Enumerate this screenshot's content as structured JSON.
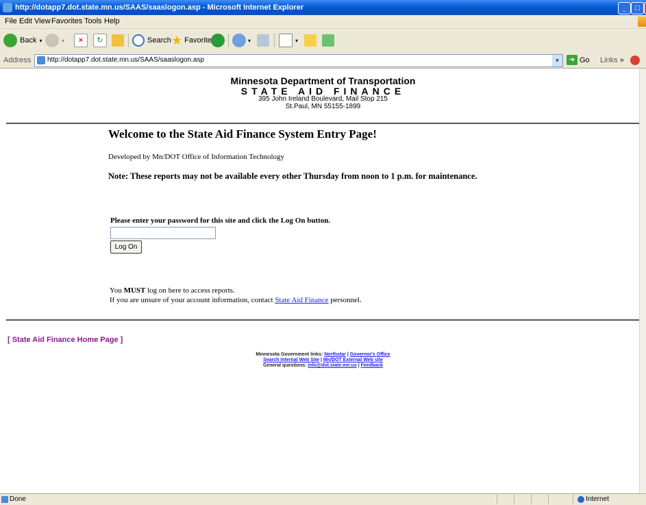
{
  "window": {
    "title": "http://dotapp7.dot.state.mn.us/SAAS/saaslogon.asp - Microsoft Internet Explorer"
  },
  "menu": {
    "items": [
      "File",
      "Edit",
      "View",
      "Favorites",
      "Tools",
      "Help"
    ]
  },
  "toolbar": {
    "back_label": "Back",
    "search_label": "Search",
    "favorites_label": "Favorites"
  },
  "address": {
    "label": "Address",
    "url": "http://dotapp7.dot.state.mn.us/SAAS/saaslogon.asp",
    "go_label": "Go",
    "links_label": "Links",
    "links_chevron": "»"
  },
  "page": {
    "header_line1": "Minnesota Department of Transportation",
    "header_line2": "STATE AID FINANCE",
    "address_line1": "395 John Ireland Boulevard, Mail Stop 215",
    "address_line2": "St.Paul, MN  55155-1899",
    "welcome": "Welcome to the State Aid Finance System Entry Page!",
    "developed_by": "Developed by Mn/DOT Office of Information Technology",
    "note": "Note: These reports may not be available every other Thursday from noon to 1 p.m. for maintenance.",
    "password_prompt": "Please enter your password for this site and click the Log On button.",
    "password_value": "",
    "logon_button": "Log On",
    "must_prefix": "You ",
    "must_word": "MUST",
    "must_suffix": " log on here to access reports.",
    "unsure_prefix": "If you are unsure of your account information, contact ",
    "unsure_link": "State Aid Finance",
    "unsure_suffix": " personnel.",
    "home_link": "[ State Aid Finance Home Page ]"
  },
  "footer": {
    "gov_prefix": "Minnesota Government links: ",
    "northstar": "Northstar",
    "sep1": " | ",
    "governor": "Governor's Office",
    "search_internal": "Search Internal Web Site",
    "sep2": " | ",
    "external": "Mn/DOT External Web site",
    "general_prefix": "General questions: ",
    "email": "info@dot.state.mn.us",
    "sep3": " | ",
    "feedback": "Feedback"
  },
  "status": {
    "left": "Done",
    "zone": "Internet"
  }
}
